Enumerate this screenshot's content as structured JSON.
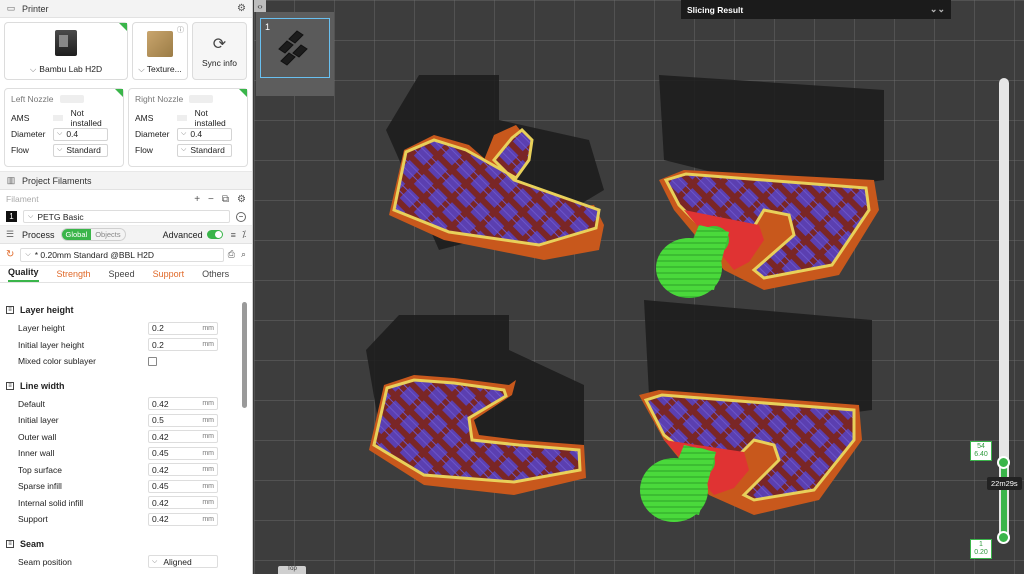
{
  "printer": {
    "section_title": "Printer",
    "name": "Bambu Lab H2D",
    "plate": "Texture...",
    "sync_label": "Sync info"
  },
  "nozzles": [
    {
      "title": "Left Nozzle",
      "ams_label": "AMS",
      "ams_value": "Not installed",
      "diameter_label": "Diameter",
      "diameter": "0.4",
      "flow_label": "Flow",
      "flow": "Standard"
    },
    {
      "title": "Right Nozzle",
      "ams_label": "AMS",
      "ams_value": "Not installed",
      "diameter_label": "Diameter",
      "diameter": "0.4",
      "flow_label": "Flow",
      "flow": "Standard"
    }
  ],
  "filaments": {
    "section_title": "Project Filaments",
    "header": "Filament",
    "items": [
      {
        "num": "1",
        "name": "PETG Basic",
        "color": "#111111"
      }
    ]
  },
  "process": {
    "section_title": "Process",
    "scope_global": "Global",
    "scope_objects": "Objects",
    "advanced_label": "Advanced",
    "preset": "* 0.20mm Standard @BBL H2D",
    "tabs": [
      "Quality",
      "Strength",
      "Speed",
      "Support",
      "Others"
    ],
    "groups": [
      {
        "title": "Layer height",
        "params": [
          {
            "label": "Layer height",
            "value": "0.2",
            "unit": "mm",
            "kind": "num"
          },
          {
            "label": "Initial layer height",
            "value": "0.2",
            "unit": "mm",
            "kind": "num"
          },
          {
            "label": "Mixed color sublayer",
            "value": "",
            "unit": "",
            "kind": "check"
          }
        ]
      },
      {
        "title": "Line width",
        "params": [
          {
            "label": "Default",
            "value": "0.42",
            "unit": "mm",
            "kind": "num"
          },
          {
            "label": "Initial layer",
            "value": "0.5",
            "unit": "mm",
            "kind": "num"
          },
          {
            "label": "Outer wall",
            "value": "0.42",
            "unit": "mm",
            "kind": "num"
          },
          {
            "label": "Inner wall",
            "value": "0.45",
            "unit": "mm",
            "kind": "num"
          },
          {
            "label": "Top surface",
            "value": "0.42",
            "unit": "mm",
            "kind": "num"
          },
          {
            "label": "Sparse infill",
            "value": "0.45",
            "unit": "mm",
            "kind": "num"
          },
          {
            "label": "Internal solid infill",
            "value": "0.42",
            "unit": "mm",
            "kind": "num"
          },
          {
            "label": "Support",
            "value": "0.42",
            "unit": "mm",
            "kind": "num"
          }
        ]
      },
      {
        "title": "Seam",
        "params": [
          {
            "label": "Seam position",
            "value": "Aligned",
            "unit": "",
            "kind": "select"
          }
        ]
      }
    ]
  },
  "viewport": {
    "plate_number": "1",
    "slicing_title": "Slicing Result",
    "top_layer": "54",
    "top_height": "6.40",
    "bottom_layer": "1",
    "bottom_height": "0.20",
    "time": "22m29s",
    "top_button": "Top"
  }
}
